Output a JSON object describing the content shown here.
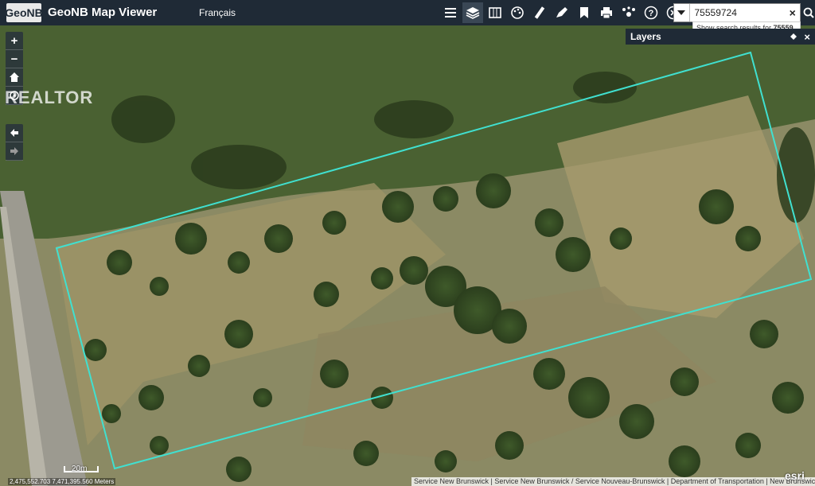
{
  "header": {
    "logo": "GeoNB",
    "title": "GeoNB Map Viewer",
    "language_link": "Français"
  },
  "toolbar": {
    "icons": [
      "list-icon",
      "layers-icon",
      "basemap-icon",
      "palette-icon",
      "measure-icon",
      "draw-icon",
      "bookmark-icon",
      "print-icon",
      "share-icon",
      "help-icon",
      "close-icon"
    ]
  },
  "search": {
    "value": "75559724",
    "clear_label": "×",
    "suggestion_prefix": "Show search results for ",
    "suggestion_bold": "75559..."
  },
  "layers_panel": {
    "title": "Layers",
    "close_label": "×"
  },
  "map_controls": {
    "zoom_in": "+",
    "zoom_out": "−"
  },
  "watermark": "REALTOR",
  "scale": {
    "label": "20m"
  },
  "coordinates": "2,475,552.703 7,471,395.560 Meters",
  "attribution": "Service New Brunswick | Service New Brunswick / Service Nouveau-Brunswick | Department of Transportation | New Brunswick Real Estate",
  "esri_logo": "esri",
  "colors": {
    "header_bg": "#1f2a36",
    "parcel_outline": "#40e0d0",
    "imagery_base": "#7a8458"
  }
}
